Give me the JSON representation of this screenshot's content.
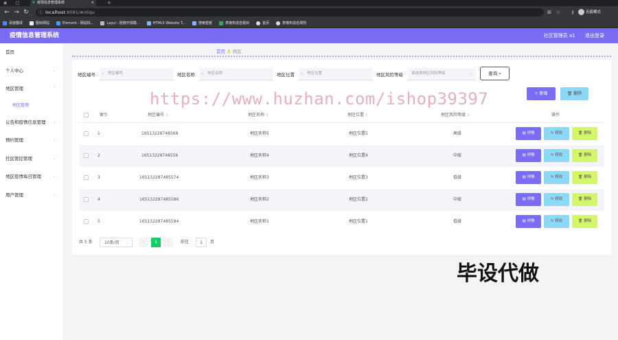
{
  "browser": {
    "tab_title": "疫情信息管理系统",
    "url_host": "localhost",
    "url_path": ":8081/#/diqu",
    "profile": "无痕模式",
    "bookmarks": [
      "百度翻译",
      "图标网站",
      "Element - 网站快...",
      "Layui - 经典开源模...",
      "HTML5 Website T...",
      "搜索壁纸",
      "表格构造名题目",
      "首页",
      "表格构造名规则"
    ]
  },
  "header": {
    "title": "疫情信息管理系统",
    "user": "社区管理员 a1",
    "logout": "退出登录"
  },
  "sidebar": {
    "items": [
      {
        "label": "首页",
        "chevron": false
      },
      {
        "label": "个人中心",
        "chevron": true
      },
      {
        "label": "地区管理",
        "chevron": true
      },
      {
        "label": "地区管理",
        "sub": true
      },
      {
        "label": "公告和疫情信息管理",
        "chevron": true
      },
      {
        "label": "预约管理",
        "chevron": true
      },
      {
        "label": "社区管控管理",
        "chevron": true
      },
      {
        "label": "地区疫情每日管理",
        "chevron": true
      },
      {
        "label": "用户管理",
        "chevron": true
      }
    ]
  },
  "breadcrumb": {
    "home": "首页",
    "current": "地区"
  },
  "search": {
    "code_label": "地区编号",
    "code_placeholder": "地区编号",
    "name_label": "地区名称",
    "name_placeholder": "地区名称",
    "loc_label": "地区位置",
    "loc_placeholder": "地区位置",
    "risk_label": "地区风险等级",
    "risk_placeholder": "请选择地区风险等级",
    "button": "查询"
  },
  "actions": {
    "add": "新增",
    "delete": "删除"
  },
  "table": {
    "headers": {
      "index": "索引",
      "code": "地区编号",
      "name": "地区名称",
      "location": "地区位置",
      "risk": "地区风险等级",
      "ops": "操作"
    },
    "rows": [
      {
        "index": "1",
        "code": "16513228748568",
        "name": "地区名称5",
        "location": "地区位置5",
        "risk": "高级"
      },
      {
        "index": "2",
        "code": "16513228748556",
        "name": "地区名称4",
        "location": "地区位置4",
        "risk": "中级"
      },
      {
        "index": "3",
        "code": "165132287485574",
        "name": "地区名称3",
        "location": "地区位置3",
        "risk": "低级"
      },
      {
        "index": "4",
        "code": "165132287485586",
        "name": "地区名称2",
        "location": "地区位置2",
        "risk": "中级"
      },
      {
        "index": "5",
        "code": "165132287485594",
        "name": "地区名称1",
        "location": "地区位置1",
        "risk": "低级"
      }
    ],
    "row_buttons": {
      "detail": "详情",
      "edit": "修改",
      "remove": "删除"
    }
  },
  "pagination": {
    "total": "共 5 条",
    "page_size": "10条/页",
    "current_page": "1",
    "goto_prefix": "前往",
    "goto_value": "1",
    "goto_suffix": "页"
  },
  "watermark": "https://www.huzhan.com/ishop39397",
  "overlay_text": "毕设代做",
  "colors": {
    "accent": "#7b6cf6",
    "info": "#8dd7f7",
    "lime": "#d4f76a",
    "page_active": "#13ce66"
  },
  "icons": [
    "vue-icon",
    "search-icon",
    "chevron-down-icon",
    "plus-icon",
    "trash-icon",
    "edit-icon",
    "detail-icon"
  ]
}
